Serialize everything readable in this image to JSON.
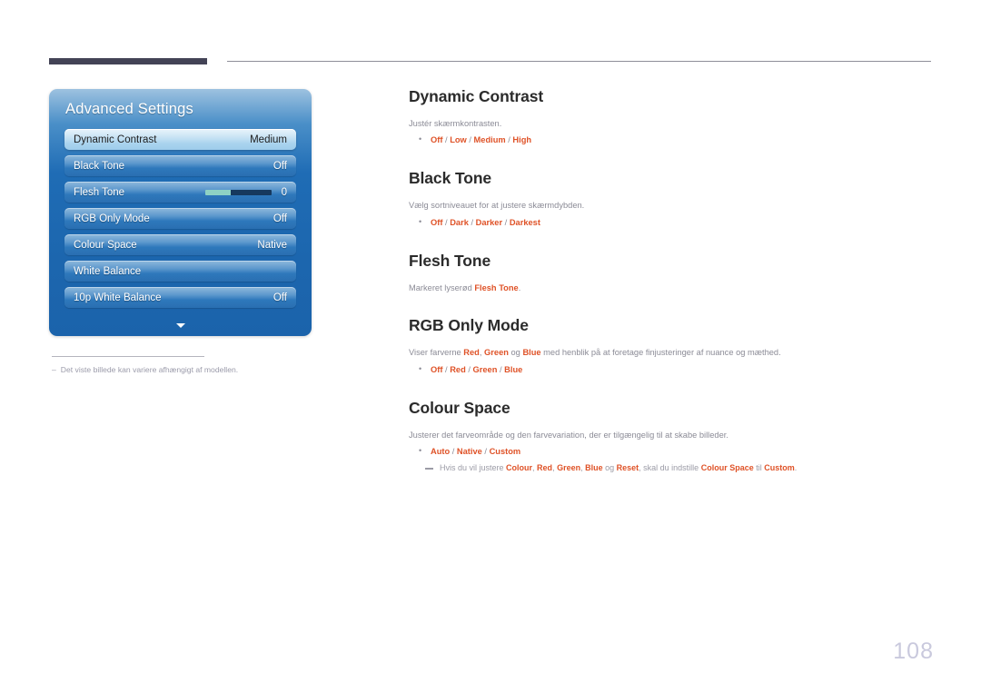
{
  "page": {
    "number": "108"
  },
  "osd": {
    "title": "Advanced Settings",
    "rows": [
      {
        "label": "Dynamic Contrast",
        "value": "Medium",
        "selected": true,
        "type": "value"
      },
      {
        "label": "Black Tone",
        "value": "Off",
        "selected": false,
        "type": "value"
      },
      {
        "label": "Flesh Tone",
        "value": "0",
        "selected": false,
        "type": "slider",
        "slider_percent": 38
      },
      {
        "label": "RGB Only Mode",
        "value": "Off",
        "selected": false,
        "type": "value"
      },
      {
        "label": "Colour Space",
        "value": "Native",
        "selected": false,
        "type": "value"
      },
      {
        "label": "White Balance",
        "value": "",
        "selected": false,
        "type": "value"
      },
      {
        "label": "10p White Balance",
        "value": "Off",
        "selected": false,
        "type": "value"
      }
    ],
    "more_icon": "chevron-down-icon"
  },
  "left_note": {
    "dash": "–",
    "text": "Det viste billede kan variere afhængigt af modellen."
  },
  "article": {
    "sections": [
      {
        "heading": "Dynamic Contrast",
        "desc": "Justér skærmkontrasten.",
        "options": [
          "Off",
          "Low",
          "Medium",
          "High"
        ]
      },
      {
        "heading": "Black Tone",
        "desc": "Vælg sortniveauet for at justere skærmdybden.",
        "options": [
          "Off",
          "Dark",
          "Darker",
          "Darkest"
        ]
      },
      {
        "heading": "Flesh Tone",
        "desc_parts": [
          {
            "t": "Markeret lyserød ",
            "hl": false
          },
          {
            "t": "Flesh Tone",
            "hl": true
          },
          {
            "t": ".",
            "hl": false
          }
        ],
        "options": []
      },
      {
        "heading": "RGB Only Mode",
        "desc_parts": [
          {
            "t": "Viser farverne ",
            "hl": false
          },
          {
            "t": "Red",
            "hl": true
          },
          {
            "t": ", ",
            "hl": false
          },
          {
            "t": "Green",
            "hl": true
          },
          {
            "t": " og ",
            "hl": false
          },
          {
            "t": "Blue",
            "hl": true
          },
          {
            "t": " med henblik på at foretage finjusteringer af nuance og mæthed.",
            "hl": false
          }
        ],
        "options": [
          "Off",
          "Red",
          "Green",
          "Blue"
        ]
      },
      {
        "heading": "Colour Space",
        "desc": "Justerer det farveområde og den farvevariation, der er tilgængelig til at skabe billeder.",
        "options": [
          "Auto",
          "Native",
          "Custom"
        ],
        "subnote_parts": [
          {
            "t": "Hvis du vil justere ",
            "hl": false
          },
          {
            "t": "Colour",
            "hl": true
          },
          {
            "t": ", ",
            "hl": false
          },
          {
            "t": "Red",
            "hl": true
          },
          {
            "t": ", ",
            "hl": false
          },
          {
            "t": "Green",
            "hl": true
          },
          {
            "t": ", ",
            "hl": false
          },
          {
            "t": "Blue",
            "hl": true
          },
          {
            "t": " og ",
            "hl": false
          },
          {
            "t": "Reset",
            "hl": true
          },
          {
            "t": ", skal du indstille ",
            "hl": false
          },
          {
            "t": "Colour Space",
            "hl": true
          },
          {
            "t": " til ",
            "hl": false
          },
          {
            "t": "Custom",
            "hl": true
          },
          {
            "t": ".",
            "hl": false
          }
        ]
      }
    ],
    "option_separator": " / "
  },
  "colors": {
    "accent": "#df5227",
    "heading": "#2b2b2b",
    "body_text": "#8b8b96",
    "panel_blue": "#1f6cb5",
    "slider_fill": "#8ed2c4",
    "slider_rest": "#16395e",
    "page_number": "#c9c9dd",
    "rule_dark": "#434356"
  }
}
